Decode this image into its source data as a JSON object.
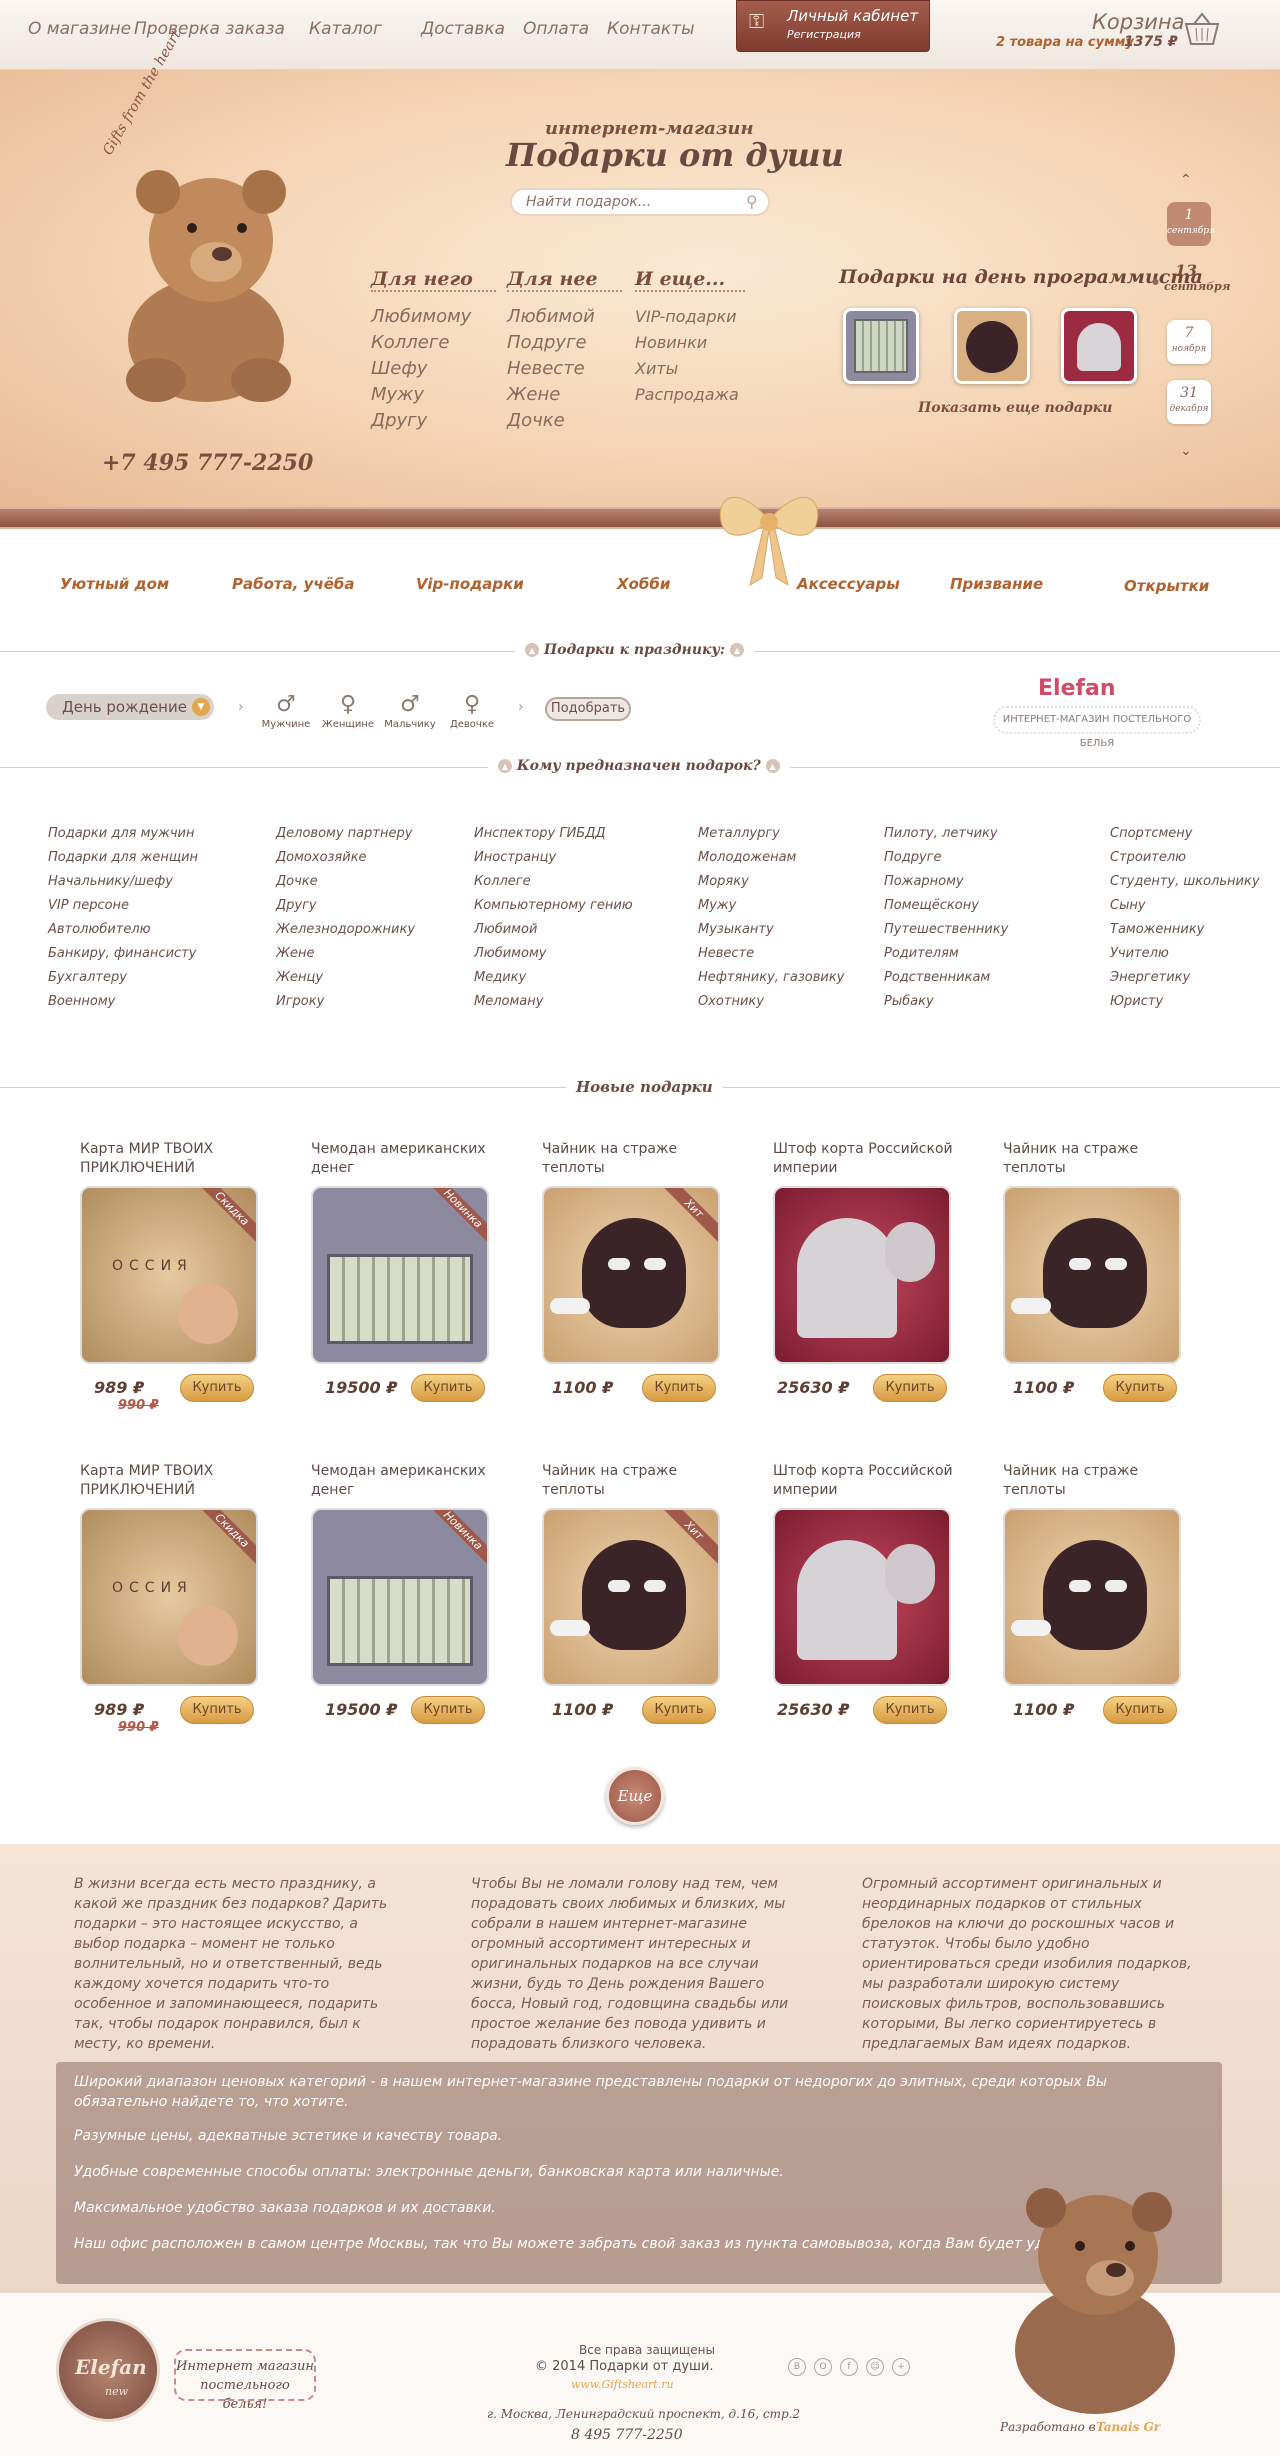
{
  "nav": {
    "about": "О магазине",
    "order_check": "Проверка заказа",
    "catalog": "Каталог",
    "delivery": "Доставка",
    "payment": "Оплата",
    "contacts": "Контакты"
  },
  "cabinet": {
    "title": "Личный кабинет",
    "sub": "Регистрация"
  },
  "cart": {
    "title": "Корзина",
    "summary": "2 товара на сумму",
    "amount": "1375 ₽"
  },
  "hero": {
    "arc_text": "Gifts from the heart",
    "shop_kind": "интернет-магазин",
    "shop_name": "Подарки от души",
    "search_placeholder": "Найти подарок...",
    "phone": "+7 495 777-2250",
    "columns": [
      {
        "title": "Для него",
        "items": [
          "Любимому",
          "Коллеге",
          "Шефу",
          "Мужу",
          "Другу"
        ]
      },
      {
        "title": "Для нее",
        "items": [
          "Любимой",
          "Подруге",
          "Невесте",
          "Жене",
          "Дочке"
        ]
      },
      {
        "title": "И еще...",
        "items": [
          "VIP-подарки",
          "Новинки",
          "Хиты",
          "Распродажа"
        ]
      }
    ],
    "featured_title": "Подарки на день программиста",
    "featured_more": "Показать еще подарки",
    "dates": [
      {
        "day": "1",
        "month": "сентября"
      },
      {
        "day": "13",
        "month": "сентября"
      },
      {
        "day": "7",
        "month": "ноября"
      },
      {
        "day": "31",
        "month": "декабря"
      }
    ]
  },
  "categories": [
    "Уютный дом",
    "Работа, учёба",
    "Vip-подарки",
    "Хобби",
    "Аксессуары",
    "Призвание",
    "Открытки"
  ],
  "holiday": {
    "section_title": "Подарки к празднику:",
    "selected": "День рождение",
    "persons": [
      "Мужчине",
      "Женщине",
      "Мальчику",
      "Девочке"
    ],
    "pick": "Подобрать",
    "partner_logo": "Elefan",
    "partner_sub": "ИНТЕРНЕТ-МАГАЗИН ПОСТЕЛЬНОГО БЕЛЬЯ"
  },
  "recipients": {
    "section_title": "Кому предназначен подарок?",
    "columns": [
      [
        "Подарки для мужчин",
        "Подарки для женщин",
        "Начальнику/шефу",
        "VIP персоне",
        "Автолюбителю",
        "Банкиру, финансисту",
        "Бухгалтеру",
        "Военному"
      ],
      [
        "Деловому партнеру",
        "Домохозяйке",
        "Дочке",
        "Другу",
        "Железнодорожнику",
        "Жене",
        "Женцу",
        "Игроку"
      ],
      [
        "Инспектору ГИБДД",
        "Иностранцу",
        "Коллеге",
        "Компьютерному гению",
        "Любимой",
        "Любимому",
        "Медику",
        "Меломану"
      ],
      [
        "Металлургу",
        "Молодоженам",
        "Моряку",
        "Мужу",
        "Музыканту",
        "Невесте",
        "Нефтянику, газовику",
        "Охотнику"
      ],
      [
        "Пилоту, летчику",
        "Подруге",
        "Пожарному",
        "Помещёскону",
        "Путешественнику",
        "Родителям",
        "Родственникам",
        "Рыбаку"
      ],
      [
        "Спортсмену",
        "Строителю",
        "Студенту, школьнику",
        "Сыну",
        "Таможеннику",
        "Учителю",
        "Энергетику",
        "Юристу"
      ]
    ]
  },
  "new_gifts": {
    "section_title": "Новые подарки",
    "buy_label": "Купить",
    "rows": [
      [
        {
          "title": "Карта МИР ТВОИХ ПРИКЛЮЧЕНИЙ",
          "price": "989 ₽",
          "old_price": "990 ₽",
          "badge": "Скидка",
          "img": "map"
        },
        {
          "title": "Чемодан американских денег",
          "price": "19500 ₽",
          "badge": "Новинка",
          "img": "case"
        },
        {
          "title": "Чайник на страже теплоты",
          "price": "1100 ₽",
          "badge": "Хит",
          "img": "kettle"
        },
        {
          "title": "Штоф корта Российской империи",
          "price": "25630 ₽",
          "img": "crown"
        },
        {
          "title": "Чайник на страже теплоты",
          "price": "1100 ₽",
          "img": "kettle"
        }
      ],
      [
        {
          "title": "Карта МИР ТВОИХ ПРИКЛЮЧЕНИЙ",
          "price": "989 ₽",
          "old_price": "990 ₽",
          "badge": "Скидка",
          "img": "map"
        },
        {
          "title": "Чемодан американских денег",
          "price": "19500 ₽",
          "badge": "Новинка",
          "img": "case"
        },
        {
          "title": "Чайник на страже теплоты",
          "price": "1100 ₽",
          "badge": "Хит",
          "img": "kettle"
        },
        {
          "title": "Штоф корта Российской империи",
          "price": "25630 ₽",
          "img": "crown"
        },
        {
          "title": "Чайник на страже теплоты",
          "price": "1100 ₽",
          "img": "kettle"
        }
      ]
    ],
    "more": "Еще"
  },
  "about": {
    "col1": "В жизни всегда есть место празднику, а какой же праздник без подарков? Дарить подарки – это настоящее искусство, а выбор подарка – момент не только волнительный, но и ответственный, ведь каждому хочется подарить что-то особенное и запоминающееся, подарить так, чтобы подарок понравился, был к месту, ко времени.",
    "col2": "Чтобы Вы не ломали голову над тем, чем порадовать своих любимых и близких, мы собрали в нашем интернет-магазине огромный ассортимент интересных и оригинальных подарков на все случаи жизни, будь то День рождения Вашего босса, Новый год, годовщина свадьбы или простое желание без повода удивить и порадовать близкого человека.",
    "col3": "Огромный ассортимент оригинальных и неординарных подарков от стильных брелоков на ключи до роскошных часов и статуэток. Чтобы было удобно ориентироваться среди изобилия подарков, мы разработали широкую систему поисковых фильтров, воспользовавшись которыми, Вы легко сориентируетесь в предлагаемых Вам идеях подарков.",
    "info": [
      "Широкий диапазон ценовых категорий - в нашем интернет-магазине представлены подарки от недорогих до элитных, среди которых Вы обязательно найдете то, что хотите.",
      "Разумные цены, адекватные эстетике и качеству товара.",
      "Удобные современные способы оплаты: электронные деньги, банковская карта или наличные.",
      "Максимальное удобство заказа подарков и их доставки.",
      "Наш офис расположен в самом центре Москвы, так что Вы можете забрать свой заказ из пункта самовывоза, когда Вам будет удобно."
    ]
  },
  "footer": {
    "badge_logo": "Elefan",
    "badge_new": "new",
    "badge_text": "Интернет магазин постельного белья!",
    "rights": "Все права защищены",
    "copyright": "© 2014 Подарки от души.",
    "site": "www.Giftsheart.ru",
    "address": "г. Москва, Ленинградский проспект, д.16, стр.2",
    "phone": "8 495 777-2250",
    "socials": [
      "В",
      "О",
      "f",
      "☺",
      "+"
    ],
    "dev_label": "Разработано в",
    "dev_name": "Tanais Gr"
  },
  "colors": {
    "accent": "#b0622f",
    "brown": "#7b4d3e",
    "ribbon": "#8c5242",
    "buy": "#e3b05a"
  }
}
